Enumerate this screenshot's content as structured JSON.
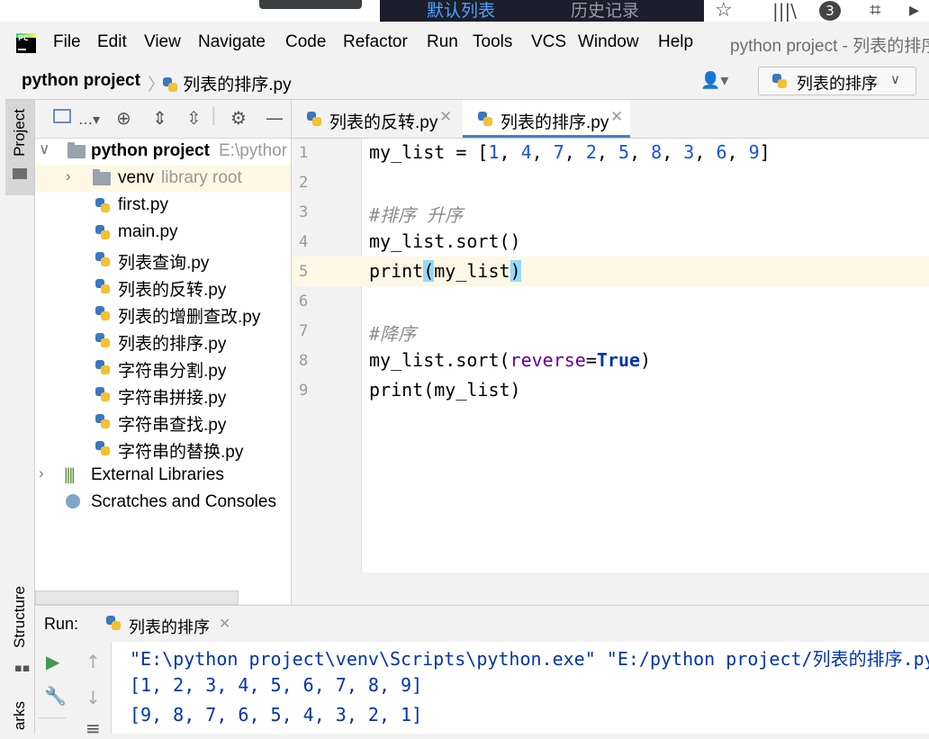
{
  "top_strip": {
    "tab1": "默认列表",
    "tab2": "历史记录",
    "badge": "3"
  },
  "menu": {
    "items": [
      "File",
      "Edit",
      "View",
      "Navigate",
      "Code",
      "Refactor",
      "Run",
      "Tools",
      "VCS",
      "Window",
      "Help"
    ],
    "window_title": "python project - 列表的排序"
  },
  "navbar": {
    "project": "python project",
    "file": "列表的排序.py",
    "run_config": "列表的排序"
  },
  "side_tabs": {
    "project": "Project",
    "structure": "Structure",
    "bookmarks": "arks"
  },
  "project_tree": {
    "root": {
      "name": "python project",
      "path": "E:\\pythor"
    },
    "venv": {
      "name": "venv",
      "hint": "library root"
    },
    "files": [
      "first.py",
      "main.py",
      "列表查询.py",
      "列表的反转.py",
      "列表的增删查改.py",
      "列表的排序.py",
      "字符串分割.py",
      "字符串拼接.py",
      "字符串查找.py",
      "字符串的替换.py"
    ],
    "external": "External Libraries",
    "scratches": "Scratches and Consoles"
  },
  "editor": {
    "tabs": [
      "列表的反转.py",
      "列表的排序.py"
    ],
    "active_tab": 1,
    "line_numbers": [
      "1",
      "2",
      "3",
      "4",
      "5",
      "6",
      "7",
      "8",
      "9"
    ],
    "lines": [
      "my_list = [1, 4, 7, 2, 5, 8, 3, 6, 9]",
      "",
      "#排序 升序",
      "my_list.sort()",
      "print(my_list)",
      "",
      "#降序",
      "my_list.sort(reverse=True)",
      "print(my_list)"
    ],
    "current_line": 5
  },
  "run": {
    "label": "Run:",
    "tab": "列表的排序",
    "output": [
      "\"E:\\python project\\venv\\Scripts\\python.exe\" \"E:/python project/列表的排序.py",
      "[1, 2, 3, 4, 5, 6, 7, 8, 9]",
      "[9, 8, 7, 6, 5, 4, 3, 2, 1]"
    ]
  },
  "colors": {
    "accent": "#4083c9",
    "keyword": "#0033b3",
    "number": "#1750eb",
    "comment": "#8c8c8c",
    "current_line": "#fcf8e3",
    "run_green": "#3d9a50"
  }
}
